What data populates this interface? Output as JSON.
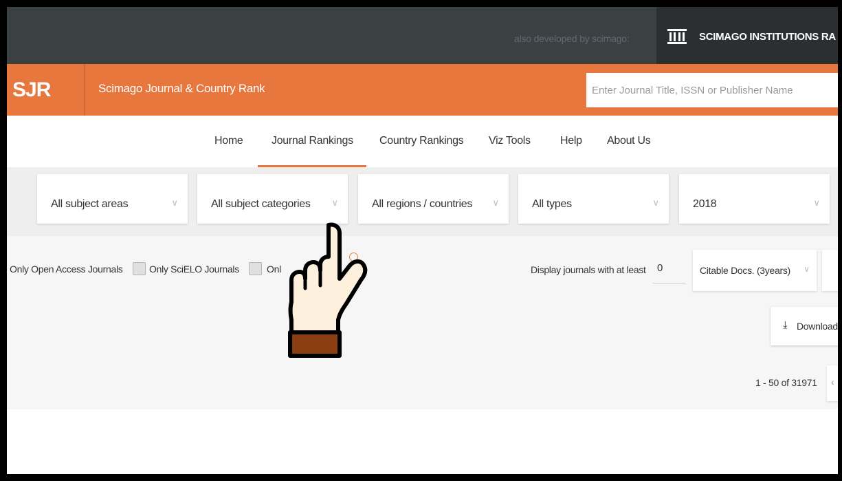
{
  "topbar": {
    "also_text": "also developed by scimago:",
    "institutions_label": "SCIMAGO INSTITUTIONS RA",
    "institutions_icon": "institution-columns-icon"
  },
  "header": {
    "logo": "SJR",
    "title": "Scimago Journal & Country Rank",
    "search_placeholder": "Enter Journal Title, ISSN or Publisher Name"
  },
  "nav": {
    "items": [
      {
        "label": "Home"
      },
      {
        "label": "Journal Rankings",
        "active": true
      },
      {
        "label": "Country Rankings"
      },
      {
        "label": "Viz Tools"
      },
      {
        "label": "Help"
      },
      {
        "label": "About Us"
      }
    ]
  },
  "filters": [
    {
      "label": "All subject areas"
    },
    {
      "label": "All subject categories"
    },
    {
      "label": "All regions / countries"
    },
    {
      "label": "All types"
    },
    {
      "label": "2018"
    }
  ],
  "options": {
    "open_access_label": "Only Open Access Journals",
    "scielo_label": "Only SciELO Journals",
    "third_label_partial": "Onl",
    "display_label": "Display journals with at least",
    "min_value": "0",
    "docs_select": "Citable Docs. (3years)",
    "download_label": "Download",
    "download_icon": "download-icon",
    "pager_text": "1 - 50 of 31971",
    "pager_prev_icon": "chevron-left-icon"
  },
  "overlay": {
    "pointer_icon": "pointing-hand-icon"
  },
  "colors": {
    "accent": "#e8773e",
    "topbar": "#3b4043",
    "institutions_bg": "#2b2f32"
  }
}
